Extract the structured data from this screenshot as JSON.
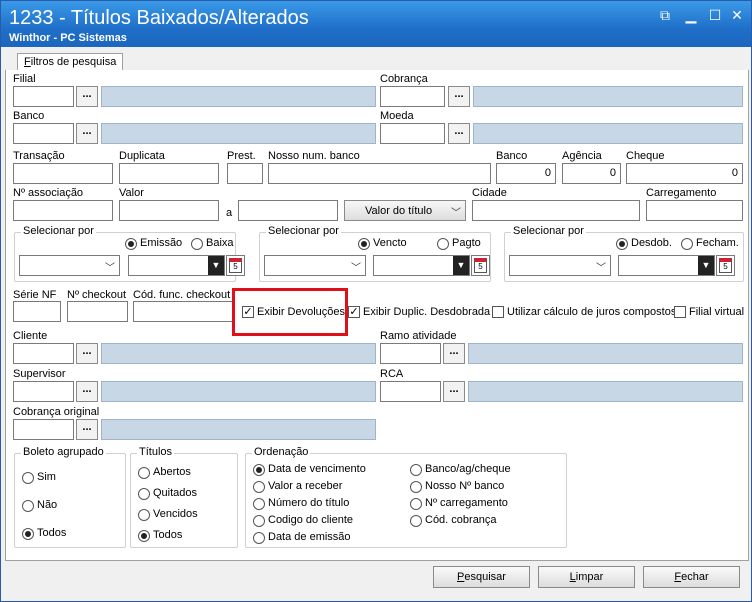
{
  "window": {
    "title": "1233 - Títulos Baixados/Alterados",
    "subtitle": "Winthor - PC Sistemas"
  },
  "tab": {
    "label_first": "F",
    "label_rest": "iltros de pesquisa"
  },
  "labels": {
    "filial": "Filial",
    "cobranca": "Cobrança",
    "banco": "Banco",
    "moeda": "Moeda",
    "transacao": "Transação",
    "duplicata": "Duplicata",
    "prest": "Prest.",
    "nosso_num": "Nosso num. banco",
    "banco2": "Banco",
    "agencia": "Agência",
    "cheque": "Cheque",
    "n_associacao": "Nº associação",
    "valor": "Valor",
    "a": "a",
    "cidade": "Cidade",
    "carregamento": "Carregamento",
    "serie_nf": "Série NF",
    "n_checkout": "Nº checkout",
    "cod_func": "Cód. func. checkout",
    "cliente": "Cliente",
    "ramo": "Ramo atividade",
    "supervisor": "Supervisor",
    "rca": "RCA",
    "cobranca_original": "Cobrança original"
  },
  "values": {
    "banco": "0",
    "agencia": "0",
    "cheque": "0"
  },
  "valor_dropdown": "Valor do título",
  "select1": {
    "title": "Selecionar por",
    "opt1": "Emissão",
    "opt2": "Baixa"
  },
  "select2": {
    "title": "Selecionar por",
    "opt1": "Vencto",
    "opt2": "Pagto"
  },
  "select3": {
    "title": "Selecionar por",
    "opt1": "Desdob.",
    "opt2": "Fecham."
  },
  "checks": {
    "exibir_devolucoes": "Exibir Devoluções",
    "exibir_duplic": "Exibir Duplic. Desdobrada",
    "juros": "Utilizar cálculo de juros compostos",
    "filial_virtual": "Filial virtual"
  },
  "boleto": {
    "title": "Boleto agrupado",
    "sim": "Sim",
    "nao": "Não",
    "todos": "Todos"
  },
  "titulos": {
    "title": "Títulos",
    "abertos": "Abertos",
    "quitados": "Quitados",
    "vencidos": "Vencidos",
    "todos": "Todos"
  },
  "ordenacao": {
    "title": "Ordenação",
    "items_left": [
      "Data de vencimento",
      "Valor a receber",
      "Número do título",
      "Codigo do cliente",
      "Data de emissão"
    ],
    "items_right": [
      "Banco/ag/cheque",
      "Nosso Nº banco",
      "Nº carregamento",
      "Cód. cobrança"
    ]
  },
  "buttons": {
    "pesquisar_u": "P",
    "pesquisar": "esquisar",
    "limpar_u": "L",
    "limpar": "impar",
    "fechar_u": "F",
    "fechar": "echar"
  },
  "cal_icon_text": "5",
  "colors": {
    "titlebar": "#1f6fc9",
    "highlight": "#e0101a",
    "disabled_field": "#c7d7e5"
  }
}
